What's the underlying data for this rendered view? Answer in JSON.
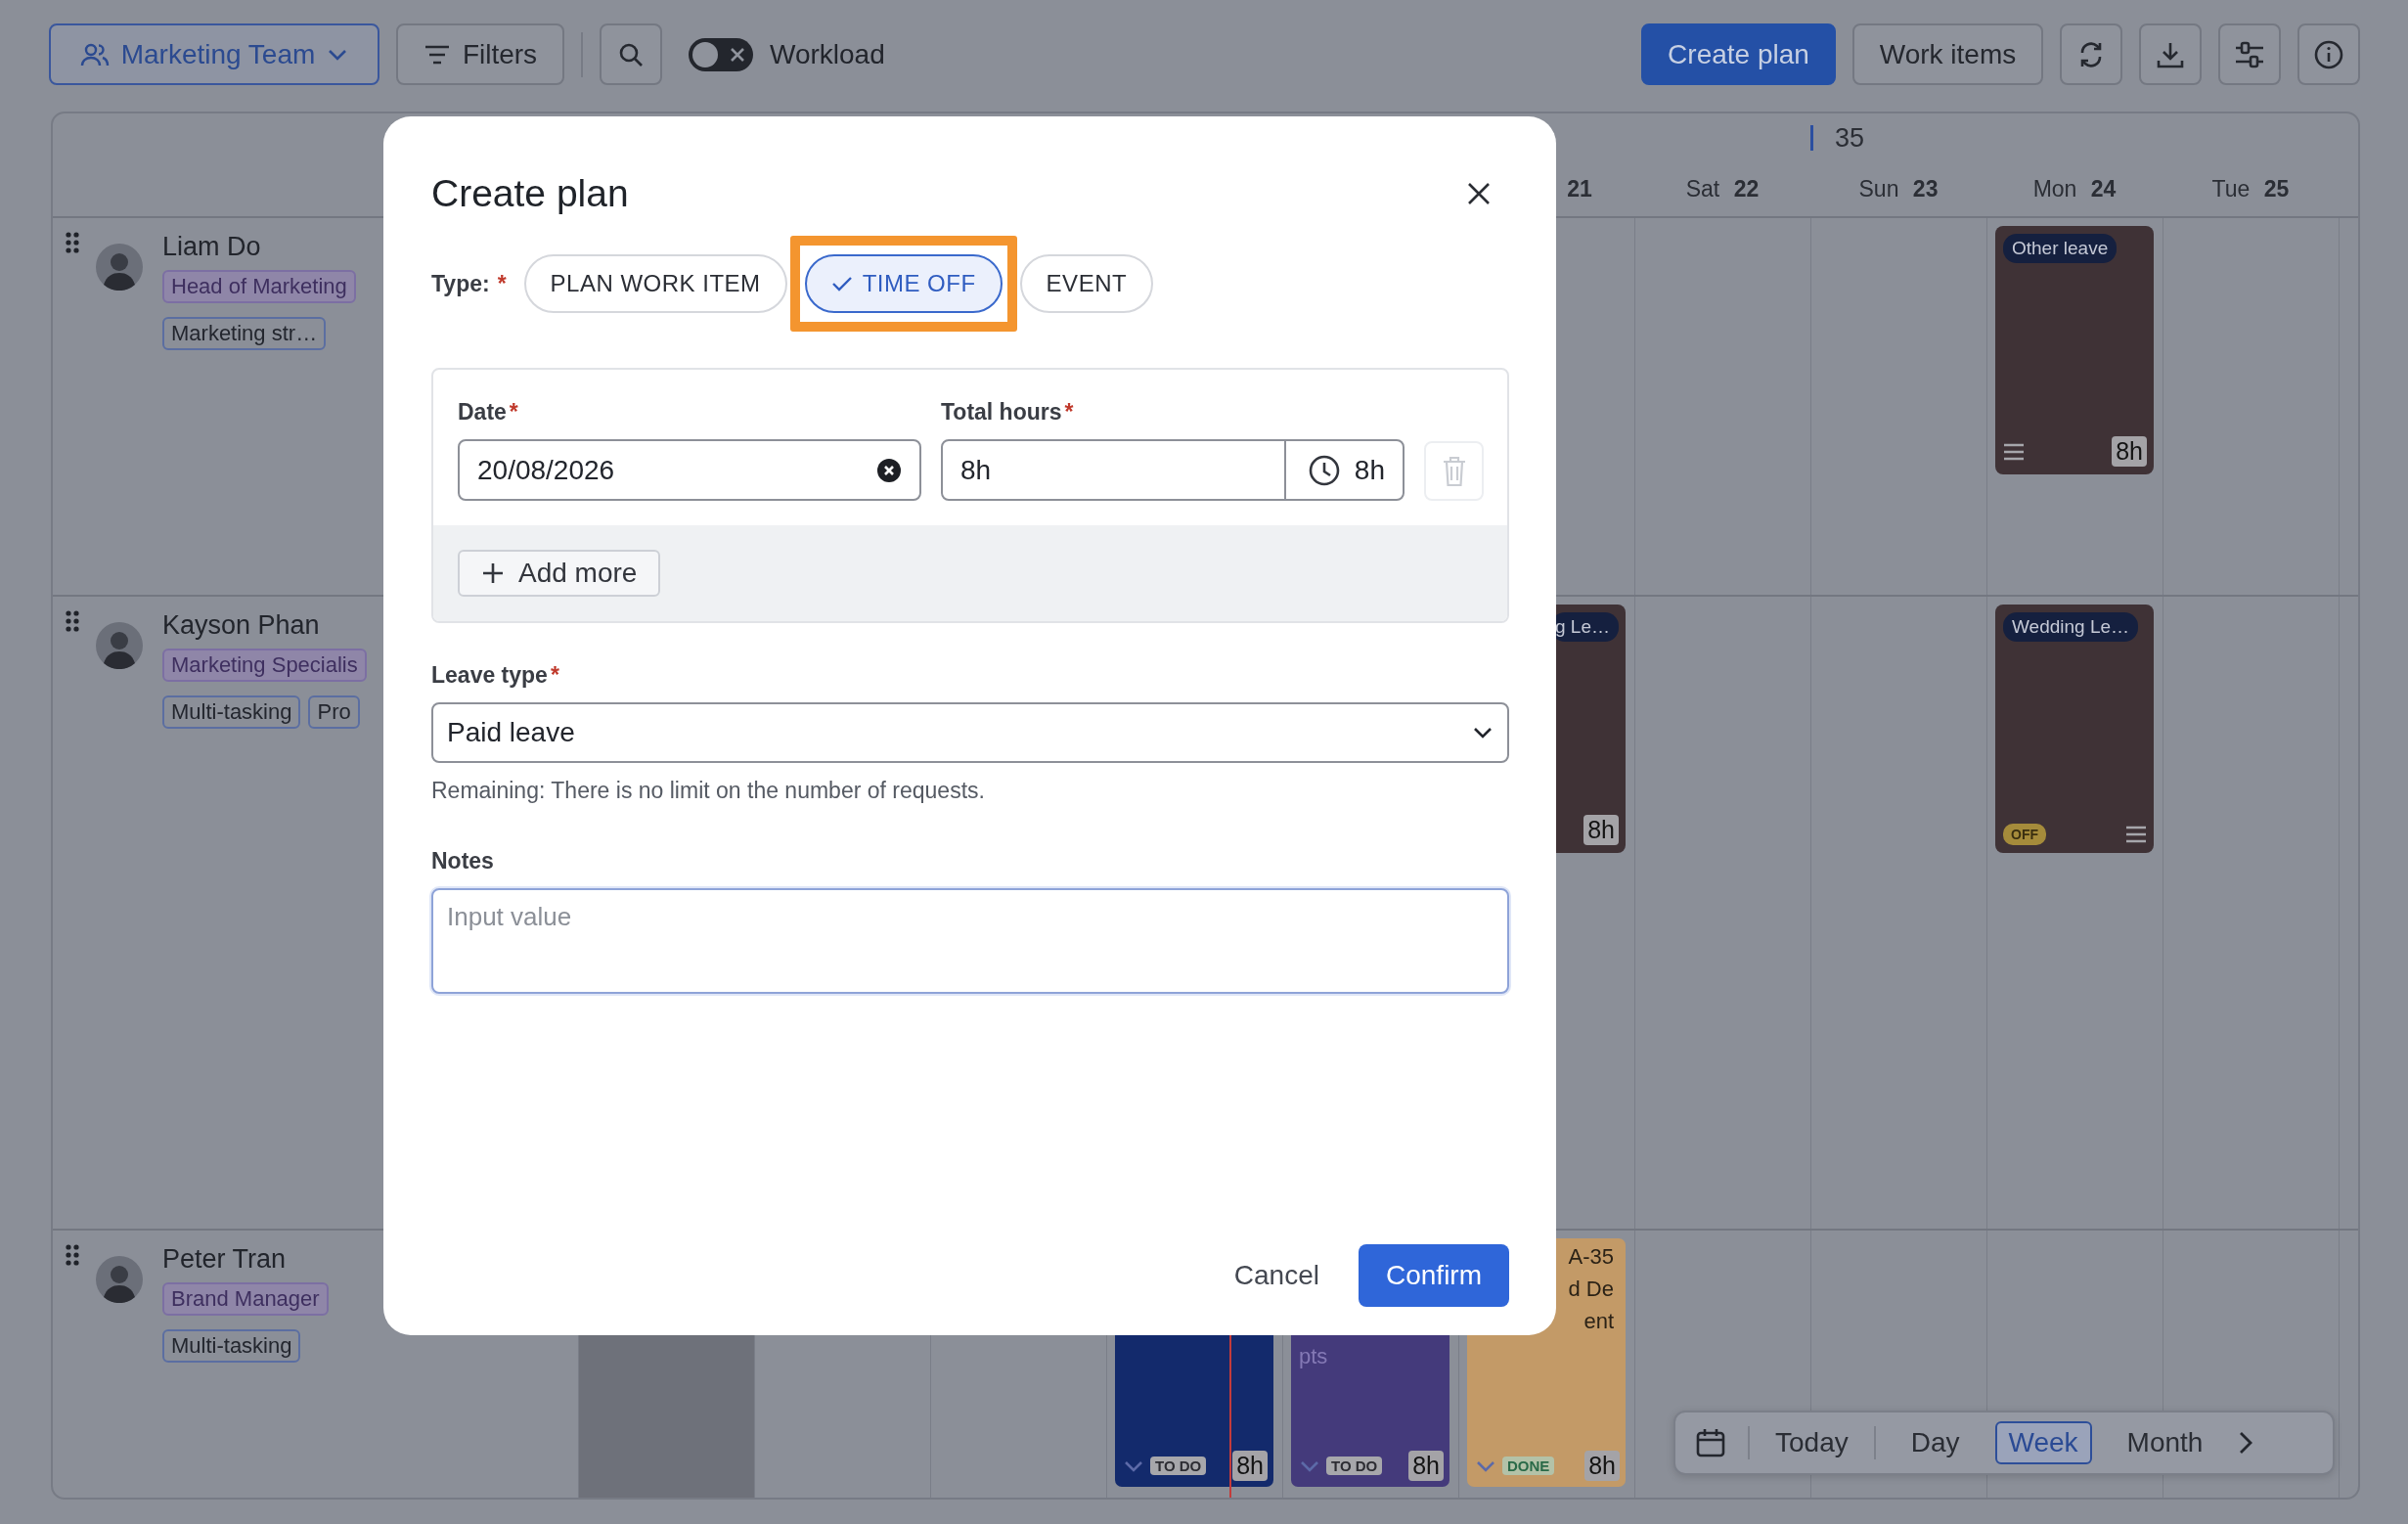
{
  "toolbar": {
    "team": "Marketing Team",
    "filters": "Filters",
    "workload": {
      "label": "Workload",
      "on": false
    },
    "create_plan": "Create plan",
    "work_items": "Work items"
  },
  "calendar": {
    "days": [
      {
        "shaded": true,
        "today": false
      },
      {
        "shaded": false,
        "today": false
      },
      {
        "shaded": false,
        "today": false
      },
      {
        "shaded": false,
        "today": true
      },
      {
        "shaded": false,
        "today": false
      },
      {
        "shaded": false,
        "today": false,
        "day": "21"
      },
      {
        "shaded": false,
        "today": false,
        "weekday": "Sat",
        "day": "22"
      },
      {
        "shaded": false,
        "today": false,
        "week": "35",
        "weekday": "Sun",
        "day": "23"
      },
      {
        "shaded": false,
        "today": false,
        "weekday": "Mon",
        "day": "24"
      },
      {
        "shaded": false,
        "today": false,
        "weekday": "Tue",
        "day": "25"
      }
    ],
    "people": [
      {
        "name": "Liam Do",
        "role": "Head of Marketing",
        "skills": [
          "Marketing str…"
        ],
        "cells": [
          {
            "kind": "empty"
          },
          {
            "kind": "empty"
          },
          {
            "kind": "empty"
          },
          {
            "kind": "empty"
          },
          {
            "kind": "empty"
          },
          {
            "kind": "empty"
          },
          {
            "kind": "empty"
          },
          {
            "kind": "empty"
          },
          {
            "kind": "leave",
            "tag": "Other leave",
            "menu": true,
            "hours": "8h",
            "covered": false
          },
          {
            "kind": "empty"
          }
        ]
      },
      {
        "name": "Kayson Phan",
        "role": "Marketing Specialis",
        "skills": [
          "Multi-tasking",
          "Pro"
        ],
        "cells": [
          {
            "kind": "empty"
          },
          {
            "kind": "empty"
          },
          {
            "kind": "empty"
          },
          {
            "kind": "empty"
          },
          {
            "kind": "empty"
          },
          {
            "kind": "leave",
            "tag": "g Le…",
            "menu": false,
            "hours": "8h",
            "covered": true
          },
          {
            "kind": "empty"
          },
          {
            "kind": "empty"
          },
          {
            "kind": "leave",
            "tag": "Wedding Le…",
            "menu": true,
            "badge": "OFF",
            "covered": false
          },
          {
            "kind": "empty"
          }
        ]
      },
      {
        "name": "Peter Tran",
        "role": "Brand Manager",
        "skills": [
          "Multi-tasking"
        ],
        "cells": [
          {
            "kind": "empty"
          },
          {
            "kind": "empty"
          },
          {
            "kind": "empty"
          },
          {
            "kind": "task",
            "color": "#132a6c",
            "status": "TO DO",
            "done": false,
            "hours": "8h"
          },
          {
            "kind": "task",
            "color": "#443a7b",
            "points": "pts",
            "status": "TO DO",
            "done": false,
            "hours": "8h"
          },
          {
            "kind": "task",
            "color": "#c39a67",
            "lines": [
              "A-35",
              "d De",
              "ent"
            ],
            "status": "DONE",
            "done": true,
            "hours": "8h"
          },
          {
            "kind": "empty"
          },
          {
            "kind": "empty"
          },
          {
            "kind": "empty"
          },
          {
            "kind": "empty"
          }
        ]
      }
    ]
  },
  "view_switcher": {
    "today": "Today",
    "views": [
      {
        "label": "Day",
        "selected": false
      },
      {
        "label": "Week",
        "selected": true
      },
      {
        "label": "Month",
        "selected": false
      }
    ]
  },
  "dialog": {
    "title": "Create plan",
    "type": {
      "label": "Type:",
      "required_mark": "*",
      "options": [
        {
          "label": "PLAN WORK ITEM",
          "selected": false,
          "highlighted": false
        },
        {
          "label": "TIME OFF",
          "selected": true,
          "highlighted": true
        },
        {
          "label": "EVENT",
          "selected": false,
          "highlighted": false
        }
      ]
    },
    "entries": [
      {
        "date": {
          "label": "Date",
          "required_mark": "*",
          "value": "20/08/2026"
        },
        "hours": {
          "label": "Total hours",
          "required_mark": "*",
          "value": "8h",
          "suffix": "8h"
        },
        "delete_disabled": true
      }
    ],
    "add_more": "Add more",
    "leave_type": {
      "label": "Leave type",
      "required_mark": "*",
      "value": "Paid leave"
    },
    "remaining": "Remaining: There is no limit on the number of requests.",
    "notes": {
      "label": "Notes",
      "placeholder": "Input value",
      "focused": true
    },
    "cancel": "Cancel",
    "confirm": "Confirm"
  }
}
